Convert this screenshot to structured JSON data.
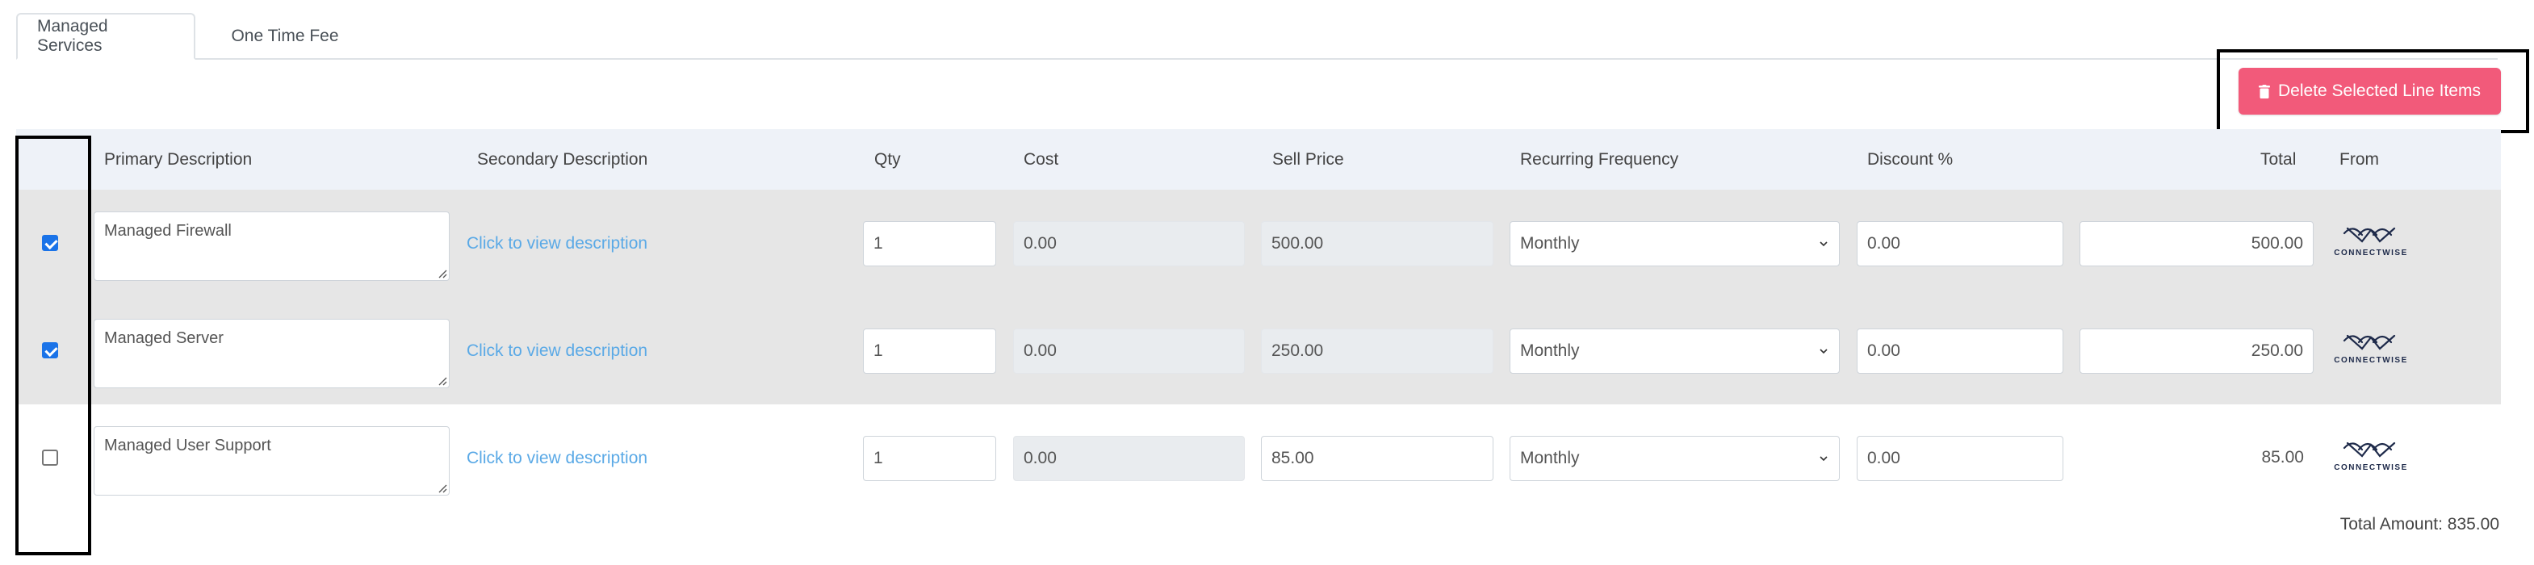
{
  "tabs": [
    {
      "label": "Managed Services",
      "active": true
    },
    {
      "label": "One Time Fee",
      "active": false
    }
  ],
  "toolbar": {
    "delete_label": "Delete Selected Line Items",
    "delete_color": "#f25a7a"
  },
  "columns": {
    "primary": "Primary Description",
    "secondary": "Secondary Description",
    "qty": "Qty",
    "cost": "Cost",
    "sell": "Sell Price",
    "frequency": "Recurring Frequency",
    "discount": "Discount %",
    "total": "Total",
    "from": "From"
  },
  "rows": [
    {
      "selected": true,
      "primary": "Managed Firewall",
      "secondary": "Click to view description",
      "qty": "1",
      "cost": "0.00",
      "sell": "500.00",
      "frequency": "Monthly",
      "discount": "0.00",
      "total": "500.00",
      "from": "CONNECTWISE"
    },
    {
      "selected": true,
      "primary": "Managed Server",
      "secondary": "Click to view description",
      "qty": "1",
      "cost": "0.00",
      "sell": "250.00",
      "frequency": "Monthly",
      "discount": "0.00",
      "total": "250.00",
      "from": "CONNECTWISE"
    },
    {
      "selected": false,
      "primary": "Managed User Support",
      "secondary": "Click to view description",
      "qty": "1",
      "cost": "0.00",
      "sell": "85.00",
      "frequency": "Monthly",
      "discount": "0.00",
      "total": "85.00",
      "from": "CONNECTWISE"
    }
  ],
  "summary": {
    "total_amount": "Total Amount: 835.00"
  },
  "icons": {
    "delete": "trash-icon",
    "select": "chevron-down-icon",
    "vendor": "connectwise-logo"
  }
}
